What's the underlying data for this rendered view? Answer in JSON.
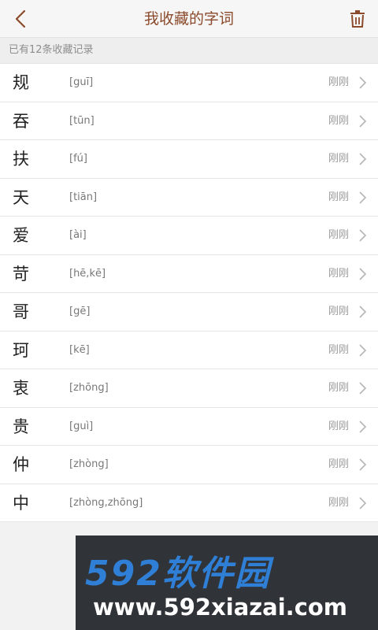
{
  "header": {
    "title": "我收藏的字词",
    "back_icon": "back-chevron-icon",
    "trash_icon": "trash-icon",
    "accent_color": "#8b4a2b"
  },
  "summary": {
    "count_text": "已有12条收藏记录"
  },
  "items": [
    {
      "char": "规",
      "pinyin": "[guī]",
      "time": "刚刚"
    },
    {
      "char": "吞",
      "pinyin": "[tūn]",
      "time": "刚刚"
    },
    {
      "char": "扶",
      "pinyin": "[fú]",
      "time": "刚刚"
    },
    {
      "char": "天",
      "pinyin": "[tiān]",
      "time": "刚刚"
    },
    {
      "char": "爱",
      "pinyin": "[ài]",
      "time": "刚刚"
    },
    {
      "char": "苛",
      "pinyin": "[hē,kē]",
      "time": "刚刚"
    },
    {
      "char": "哥",
      "pinyin": "[gē]",
      "time": "刚刚"
    },
    {
      "char": "珂",
      "pinyin": "[kē]",
      "time": "刚刚"
    },
    {
      "char": "衷",
      "pinyin": "[zhōng]",
      "time": "刚刚"
    },
    {
      "char": "贵",
      "pinyin": "[guì]",
      "time": "刚刚"
    },
    {
      "char": "仲",
      "pinyin": "[zhòng]",
      "time": "刚刚"
    },
    {
      "char": "中",
      "pinyin": "[zhòng,zhōng]",
      "time": "刚刚"
    }
  ],
  "watermark": {
    "logo_text": "592软件园",
    "url_text": "www.592xiazai.com"
  }
}
